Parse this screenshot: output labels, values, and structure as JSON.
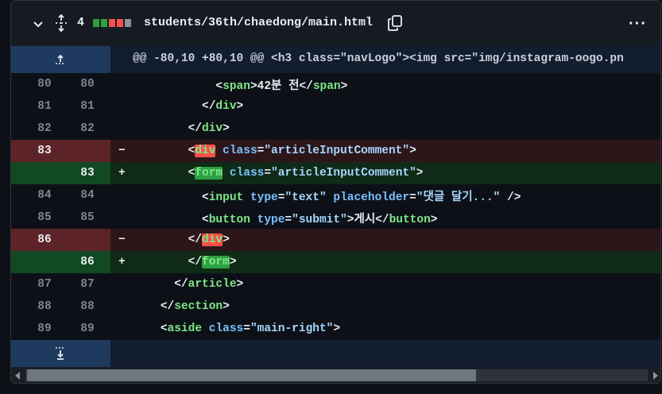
{
  "file": {
    "change_count": "4",
    "path": "students/36th/chaedong/main.html",
    "stat_colors": [
      "#2ea043",
      "#2ea043",
      "#f85149",
      "#f85149",
      "#8b949e"
    ]
  },
  "hunk_header": "@@ -80,10 +80,10 @@ <h3 class=\"navLogo\"><img src=\"img/instagram-oogo.pn",
  "lines": [
    {
      "old": "80",
      "new": "80",
      "sign": "",
      "type": "ctx",
      "indent": "            ",
      "parts": [
        [
          "p",
          "<"
        ],
        [
          "t",
          "span"
        ],
        [
          "p",
          ">42분 전</"
        ],
        [
          "t",
          "span"
        ],
        [
          "p",
          ">"
        ]
      ]
    },
    {
      "old": "81",
      "new": "81",
      "sign": "",
      "type": "ctx",
      "indent": "          ",
      "parts": [
        [
          "p",
          "</"
        ],
        [
          "t",
          "div"
        ],
        [
          "p",
          ">"
        ]
      ]
    },
    {
      "old": "82",
      "new": "82",
      "sign": "",
      "type": "ctx",
      "indent": "        ",
      "parts": [
        [
          "p",
          "</"
        ],
        [
          "t",
          "div"
        ],
        [
          "p",
          ">"
        ]
      ]
    },
    {
      "old": "83",
      "new": "",
      "sign": "−",
      "type": "del",
      "indent": "        ",
      "parts": [
        [
          "p",
          "<"
        ],
        [
          "hd",
          "div"
        ],
        [
          "p",
          " "
        ],
        [
          "a",
          "class"
        ],
        [
          "p",
          "="
        ],
        [
          "s",
          "\"articleInputComment\""
        ],
        [
          "p",
          ">"
        ]
      ]
    },
    {
      "old": "",
      "new": "83",
      "sign": "+",
      "type": "add",
      "indent": "        ",
      "parts": [
        [
          "p",
          "<"
        ],
        [
          "ha",
          "form"
        ],
        [
          "p",
          " "
        ],
        [
          "a",
          "class"
        ],
        [
          "p",
          "="
        ],
        [
          "s",
          "\"articleInputComment\""
        ],
        [
          "p",
          ">"
        ]
      ]
    },
    {
      "old": "84",
      "new": "84",
      "sign": "",
      "type": "ctx",
      "indent": "          ",
      "parts": [
        [
          "p",
          "<"
        ],
        [
          "t",
          "input"
        ],
        [
          "p",
          " "
        ],
        [
          "a",
          "type"
        ],
        [
          "p",
          "="
        ],
        [
          "s",
          "\"text\""
        ],
        [
          "p",
          " "
        ],
        [
          "a",
          "placeholder"
        ],
        [
          "p",
          "="
        ],
        [
          "s",
          "\"댓글 달기...\""
        ],
        [
          "p",
          " />"
        ]
      ]
    },
    {
      "old": "85",
      "new": "85",
      "sign": "",
      "type": "ctx",
      "indent": "          ",
      "parts": [
        [
          "p",
          "<"
        ],
        [
          "t",
          "button"
        ],
        [
          "p",
          " "
        ],
        [
          "a",
          "type"
        ],
        [
          "p",
          "="
        ],
        [
          "s",
          "\"submit\""
        ],
        [
          "p",
          ">게시</"
        ],
        [
          "t",
          "button"
        ],
        [
          "p",
          ">"
        ]
      ]
    },
    {
      "old": "86",
      "new": "",
      "sign": "−",
      "type": "del",
      "indent": "        ",
      "parts": [
        [
          "p",
          "</"
        ],
        [
          "hd",
          "div"
        ],
        [
          "p",
          ">"
        ]
      ]
    },
    {
      "old": "",
      "new": "86",
      "sign": "+",
      "type": "add",
      "indent": "        ",
      "parts": [
        [
          "p",
          "</"
        ],
        [
          "ha",
          "form"
        ],
        [
          "p",
          ">"
        ]
      ]
    },
    {
      "old": "87",
      "new": "87",
      "sign": "",
      "type": "ctx",
      "indent": "      ",
      "parts": [
        [
          "p",
          "</"
        ],
        [
          "t",
          "article"
        ],
        [
          "p",
          ">"
        ]
      ]
    },
    {
      "old": "88",
      "new": "88",
      "sign": "",
      "type": "ctx",
      "indent": "    ",
      "parts": [
        [
          "p",
          "</"
        ],
        [
          "t",
          "section"
        ],
        [
          "p",
          ">"
        ]
      ]
    },
    {
      "old": "89",
      "new": "89",
      "sign": "",
      "type": "ctx",
      "indent": "    ",
      "parts": [
        [
          "p",
          "<"
        ],
        [
          "t",
          "aside"
        ],
        [
          "p",
          " "
        ],
        [
          "a",
          "class"
        ],
        [
          "p",
          "="
        ],
        [
          "s",
          "\"main-right\""
        ],
        [
          "p",
          ">"
        ]
      ]
    }
  ],
  "icons": {
    "collapse": "chevron-down-icon",
    "expand": "unfold-icon",
    "copy": "copy-icon",
    "more": "kebab-icon",
    "expand_up": "expand-up-icon",
    "expand_down": "expand-down-icon"
  }
}
